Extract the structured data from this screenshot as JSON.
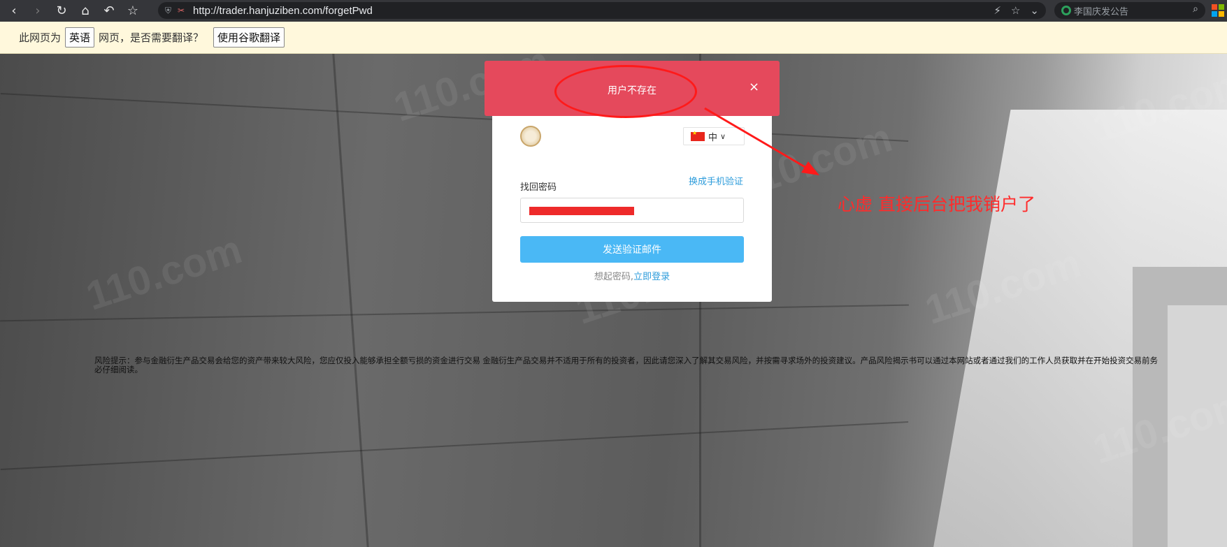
{
  "browser": {
    "url": "http://trader.hanjuziben.com/forgetPwd",
    "search_text": "李国庆发公告",
    "icons": [
      "back-icon",
      "forward-icon",
      "reload-icon",
      "home-icon",
      "undo-icon",
      "star-icon"
    ]
  },
  "translate": {
    "prefix": "此网页为",
    "language": "英语",
    "middle": "网页，是否需要翻译？",
    "button": "使用谷歌翻译"
  },
  "toast": {
    "message": "用户不存在",
    "close": "×"
  },
  "card": {
    "language_label": "中",
    "title": "找回密码",
    "switch_link": "换成手机验证",
    "send_button": "发送验证邮件",
    "footer_text": "想起密码,",
    "footer_link": "立即登录"
  },
  "risk_notice": "风险提示：参与金融衍生产品交易会给您的资产带来较大风险，您应仅投入能够承担全额亏损的资金进行交易 金融衍生产品交易并不适用于所有的投资者，因此请您深入了解其交易风险，并按需寻求场外的投资建议。产品风险揭示书可以通过本网站或者通过我们的工作人员获取并在开始投资交易前务必仔细阅读。",
  "annotation": {
    "text": "心虚 直接后台把我销户了",
    "color": "#ff2b2b"
  },
  "watermark": "110.com",
  "colors": {
    "toast_bg": "#e5495c",
    "button_bg": "#4ab8f5",
    "link": "#2d9cdb"
  }
}
